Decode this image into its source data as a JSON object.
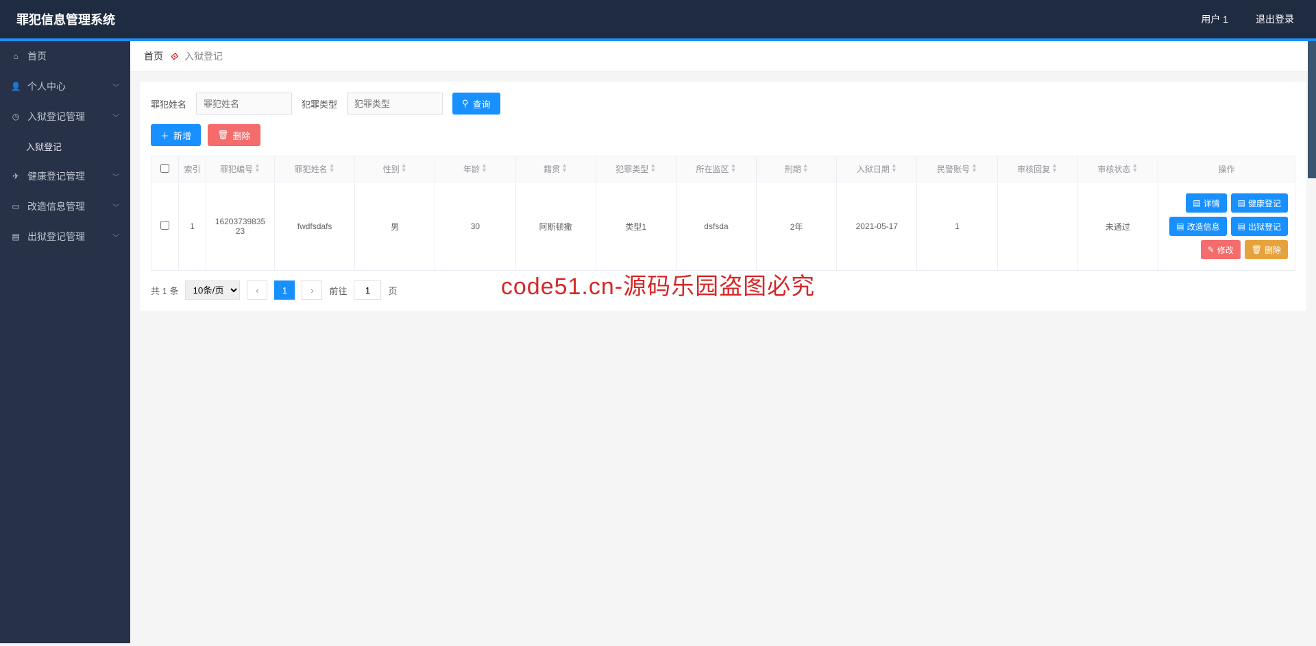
{
  "watermark_text": "code51.cn",
  "big_watermark": "code51.cn-源码乐园盗图必究",
  "header": {
    "title": "罪犯信息管理系统",
    "user": "用户 1",
    "logout": "退出登录"
  },
  "sidebar": {
    "items": [
      {
        "label": "首页",
        "icon": "home",
        "expandable": false
      },
      {
        "label": "个人中心",
        "icon": "user",
        "expandable": true
      },
      {
        "label": "入狱登记管理",
        "icon": "clock",
        "expandable": true
      },
      {
        "label": "入狱登记",
        "icon": "",
        "sub": true
      },
      {
        "label": "健康登记管理",
        "icon": "plane",
        "expandable": true
      },
      {
        "label": "改造信息管理",
        "icon": "window",
        "expandable": true
      },
      {
        "label": "出狱登记管理",
        "icon": "file",
        "expandable": true
      }
    ]
  },
  "breadcrumb": {
    "home": "首页",
    "icon": "⟐",
    "current": "入狱登记"
  },
  "search": {
    "label1": "罪犯姓名",
    "ph1": "罪犯姓名",
    "label2": "犯罪类型",
    "ph2": "犯罪类型",
    "query_btn": "查询"
  },
  "actions": {
    "add": "新增",
    "delete": "删除"
  },
  "table": {
    "headers": [
      "索引",
      "罪犯编号",
      "罪犯姓名",
      "性别",
      "年龄",
      "籍贯",
      "犯罪类型",
      "所在监区",
      "刑期",
      "入狱日期",
      "民警账号",
      "审核回复",
      "审核状态",
      "操作"
    ],
    "rows": [
      {
        "idx": "1",
        "num": "16203739835\n23",
        "name": "fwdfsdafs",
        "sex": "男",
        "age": "30",
        "origin": "阿斯顿撒",
        "type": "类型1",
        "zone": "dsfsda",
        "term": "2年",
        "date": "2021-05-17",
        "police": "1",
        "reply": "",
        "status": "未通过"
      }
    ],
    "op_buttons": {
      "detail": "详情",
      "health": "健康登记",
      "reform": "改造信息",
      "release": "出狱登记",
      "edit": "修改",
      "del": "删除"
    }
  },
  "pager": {
    "total": "共 1 条",
    "size": "10条/页",
    "page": "1",
    "goto_label": "前往",
    "goto_val": "1",
    "goto_suffix": "页"
  }
}
